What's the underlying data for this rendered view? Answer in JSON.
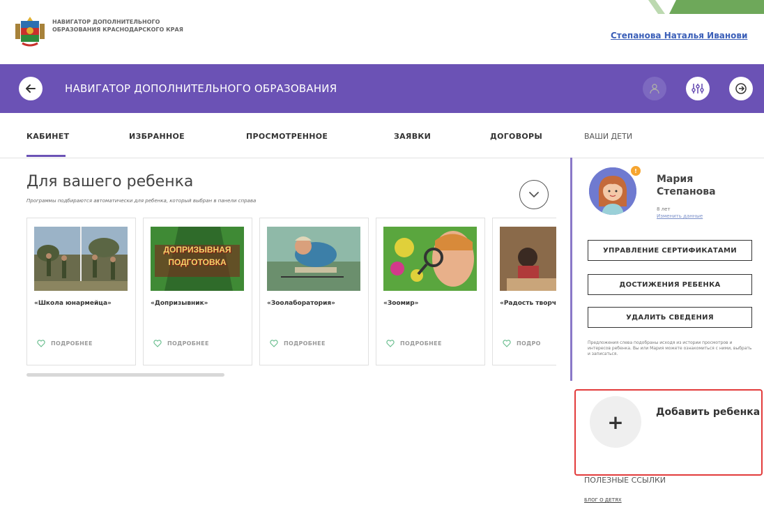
{
  "header": {
    "org_name": "НАВИГАТОР ДОПОЛНИТЕЛЬНОГО ОБРАЗОВАНИЯ КРАСНОДАРСКОГО КРАЯ",
    "user_name": "Степанова Наталья Иванови"
  },
  "navbar": {
    "title": "НАВИГАТОР ДОПОЛНИТЕЛЬНОГО ОБРАЗОВАНИЯ",
    "color": "#6b52b5"
  },
  "tabs": [
    {
      "label": "КАБИНЕТ",
      "active": true
    },
    {
      "label": "ИЗБРАННОЕ"
    },
    {
      "label": "ПРОСМОТРЕННОЕ"
    },
    {
      "label": "ЗАЯВКИ"
    },
    {
      "label": "ДОГОВОРЫ"
    }
  ],
  "main": {
    "title": "Для вашего ребенка",
    "subtitle": "Программы подбираются автоматически для ребенка, который выбран в панели справа",
    "cards": [
      {
        "name": "«Школа юнармейца»",
        "more": "ПОДРОБНЕЕ"
      },
      {
        "name": "«Допризывник»",
        "more": "ПОДРОБНЕЕ",
        "image_text": "ДОПРИЗЫВНАЯ ПОДГОТОВКА"
      },
      {
        "name": "«Зоолаборатория»",
        "more": "ПОДРОБНЕЕ"
      },
      {
        "name": "«Зоомир»",
        "more": "ПОДРОБНЕЕ"
      },
      {
        "name": "«Радость творчества",
        "more": "ПОДРО"
      }
    ]
  },
  "kids": {
    "title": "ВАШИ ДЕТИ",
    "child": {
      "name": "Мария Степанова",
      "age": "8 лет",
      "edit": "Изменить данные",
      "badge": "!"
    },
    "buttons": {
      "certs": "УПРАВЛЕНИЕ СЕРТИФИКАТАМИ",
      "achievements": "ДОСТИЖЕНИЯ РЕБЕНКА",
      "delete": "УДАЛИТЬ СВЕДЕНИЯ"
    },
    "note": "Предложения слева подобраны исходя из истории просмотров и интересов ребенка. Вы или Мария можете ознакомиться с ними, выбрать и записаться.",
    "add": {
      "plus": "+",
      "label": "Добавить ребенка",
      "highlight_color": "#e23b3b"
    }
  },
  "links": {
    "title": "ПОЛЕЗНЫЕ ССЫЛКИ",
    "blog": "БЛОГ О ДЕТЯХ"
  }
}
